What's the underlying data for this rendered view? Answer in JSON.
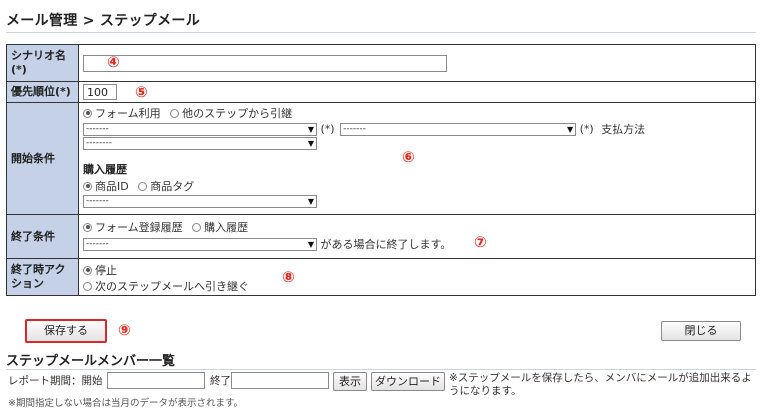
{
  "page": {
    "breadcrumb_root": "メール管理",
    "breadcrumb_sep": ">",
    "breadcrumb_current": "ステップメール"
  },
  "form": {
    "scenario_label": "シナリオ名(*)",
    "scenario_value": "",
    "priority_label": "優先順位(*)",
    "priority_value": "100",
    "start_label": "開始条件",
    "start_radio_form": "フォーム利用",
    "start_radio_other": "他のステップから引継",
    "select_default_a": "-------",
    "select_default_b": "--------",
    "required_mark": "(*)",
    "payment_label": "支払方法",
    "purchase_history_label": "購入履歴",
    "radio_product_id": "商品ID",
    "radio_product_tag": "商品タグ",
    "end_label": "終了条件",
    "end_radio_form": "フォーム登録履歴",
    "end_radio_purchase": "購入履歴",
    "end_suffix": "がある場合に終了します。",
    "end_action_label": "終了時アクション",
    "action_stop": "停止",
    "action_next": "次のステップメールへ引き継ぐ"
  },
  "markers": {
    "m4": "④",
    "m5": "⑤",
    "m6": "⑥",
    "m7": "⑦",
    "m8": "⑧",
    "m9": "⑨"
  },
  "buttons": {
    "save": "保存する",
    "close": "閉じる",
    "show": "表示",
    "download": "ダウンロード"
  },
  "members": {
    "title": "ステップメールメンバー一覧",
    "report_label": "レポート期間：開始",
    "end_label": "終了",
    "note_save": "※ステップメールを保存したら、メンバにメールが追加出来るようになります。",
    "note_period": "※期間指定しない場合は当月のデータが表示されます。"
  },
  "colors": {
    "label_bg": "#c5d1e6",
    "marker": "#e8261c",
    "save_outline": "#d8282b"
  }
}
